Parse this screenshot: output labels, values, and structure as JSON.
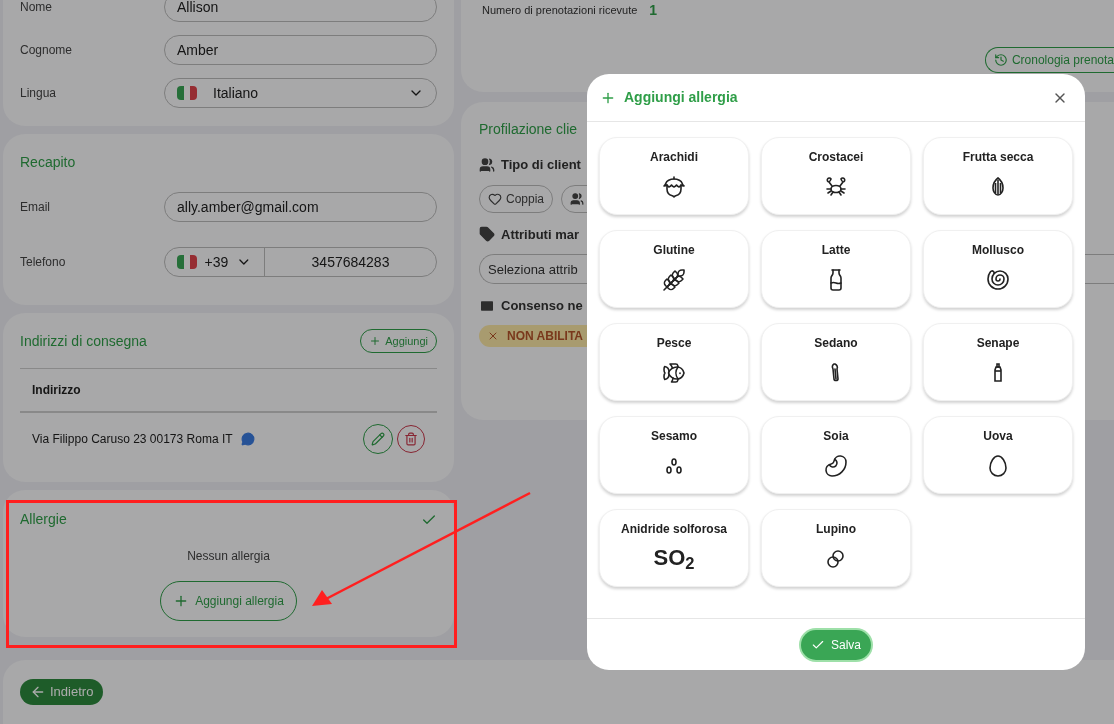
{
  "customer": {
    "fields": [
      {
        "kind": "text",
        "label": "Nome",
        "value": "Allison"
      },
      {
        "kind": "text",
        "label": "Cognome",
        "value": "Amber"
      },
      {
        "kind": "select",
        "label": "Lingua",
        "value": "Italiano"
      }
    ]
  },
  "contact": {
    "title": "Recapito",
    "email_label": "Email",
    "email": "ally.amber@gmail.com",
    "phone_label": "Telefono",
    "phone_prefix": "+39",
    "phone_number": "3457684283"
  },
  "addresses": {
    "title": "Indirizzi di consegna",
    "add_button": "Aggiungi",
    "column": "Indirizzo",
    "rows": [
      {
        "address": "Via Filippo Caruso 23 00173 Roma IT"
      }
    ]
  },
  "allergies": {
    "title": "Allergie",
    "empty_text": "Nessun allergia",
    "add_button": "Aggiungi allergia"
  },
  "back_button": "Indietro",
  "bookings": {
    "label": "Numero di prenotazioni ricevute",
    "count": "1",
    "history_button": "Cronologia prenota"
  },
  "profiling": {
    "title": "Profilazione clie",
    "client_type_label": "Tipo di client",
    "chips": [
      "Coppia"
    ],
    "marketing_label": "Attributi mar",
    "marketing_placeholder": "Seleziona attrib",
    "consent_label": "Consenso ne",
    "consent_badge": "NON ABILITA"
  },
  "modal": {
    "title": "Aggiungi allergia",
    "save_button": "Salva",
    "allergens": [
      {
        "name": "Arachidi",
        "kind": "icon",
        "selected": false
      },
      {
        "name": "Crostacei",
        "kind": "icon",
        "selected": false
      },
      {
        "name": "Frutta secca",
        "kind": "icon",
        "selected": false
      },
      {
        "name": "Glutine",
        "kind": "icon",
        "selected": false
      },
      {
        "name": "Latte",
        "kind": "icon",
        "selected": false
      },
      {
        "name": "Mollusco",
        "kind": "icon",
        "selected": false
      },
      {
        "name": "Pesce",
        "kind": "icon",
        "selected": false
      },
      {
        "name": "Sedano",
        "kind": "icon",
        "selected": false
      },
      {
        "name": "Senape",
        "kind": "icon",
        "selected": false
      },
      {
        "name": "Sesamo",
        "kind": "icon",
        "selected": false
      },
      {
        "name": "Soia",
        "kind": "icon",
        "selected": false
      },
      {
        "name": "Uova",
        "kind": "icon",
        "selected": false
      },
      {
        "name": "Anidride solforosa",
        "kind": "symbol",
        "symbol": "SO$_{2}$",
        "selected": false
      },
      {
        "name": "Lupino",
        "kind": "icon",
        "selected": false
      }
    ]
  }
}
